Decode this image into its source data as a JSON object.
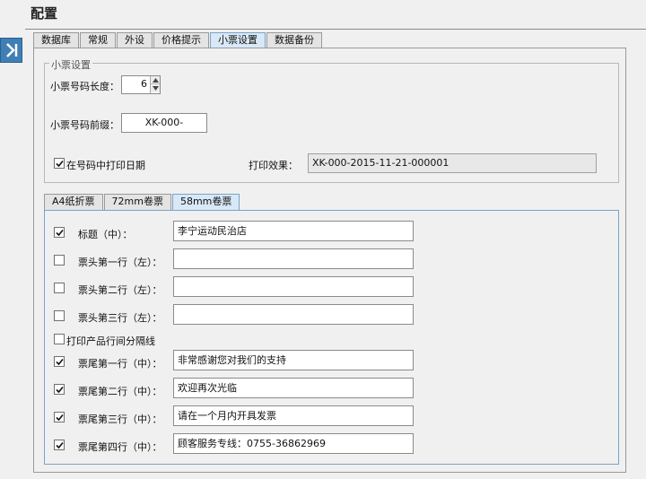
{
  "page": {
    "title": "配置"
  },
  "tabs": [
    {
      "label": "数据库",
      "active": false
    },
    {
      "label": "常规",
      "active": false
    },
    {
      "label": "外设",
      "active": false
    },
    {
      "label": "价格提示",
      "active": false
    },
    {
      "label": "小票设置",
      "active": true
    },
    {
      "label": "数据备份",
      "active": false
    }
  ],
  "receipt": {
    "group_label": "小票设置",
    "length_label": "小票号码长度：",
    "length_value": "6",
    "prefix_label": "小票号码前缀：",
    "prefix_value": "XK-000-",
    "print_date_label": "在号码中打印日期",
    "print_date_checked": true,
    "preview_label": "打印效果：",
    "preview_value": "XK-000-2015-11-21-000001"
  },
  "subtabs": [
    {
      "label": "A4纸折票",
      "active": false
    },
    {
      "label": "72mm卷票",
      "active": false
    },
    {
      "label": "58mm卷票",
      "active": true
    }
  ],
  "rows": [
    {
      "label": "标题（中）：",
      "checked": true,
      "value": "李宁运动民治店"
    },
    {
      "label": "票头第一行（左）：",
      "checked": false,
      "value": ""
    },
    {
      "label": "票头第二行（左）：",
      "checked": false,
      "value": ""
    },
    {
      "label": "票头第三行（左）：",
      "checked": false,
      "value": ""
    }
  ],
  "separator": {
    "label": "打印产品行间分隔线",
    "checked": false
  },
  "footer_rows": [
    {
      "label": "票尾第一行（中）：",
      "checked": true,
      "value": "非常感谢您对我们的支持"
    },
    {
      "label": "票尾第二行（中）：",
      "checked": true,
      "value": "欢迎再次光临"
    },
    {
      "label": "票尾第三行（中）：",
      "checked": true,
      "value": "请在一个月内开具发票"
    },
    {
      "label": "票尾第四行（中）：",
      "checked": true,
      "value": "顾客服务专线：0755-36862969"
    }
  ],
  "colors": {
    "accent": "#3f7fb5",
    "active_tab": "#d8e8f6",
    "border": "#9a9a9a"
  }
}
